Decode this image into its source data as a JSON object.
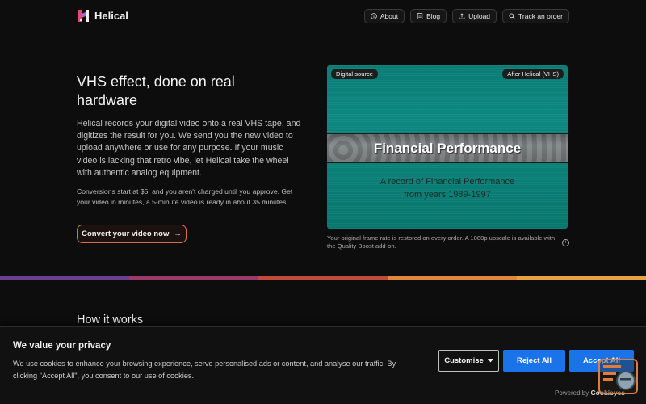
{
  "header": {
    "brand": "Helical",
    "nav": [
      {
        "label": "About",
        "icon": "info-icon"
      },
      {
        "label": "Blog",
        "icon": "document-icon"
      },
      {
        "label": "Upload",
        "icon": "upload-icon"
      },
      {
        "label": "Track an order",
        "icon": "search-icon"
      }
    ]
  },
  "hero": {
    "title": "VHS effect, done on real hardware",
    "description": "Helical records your digital video onto a real VHS tape, and digitizes the result for you. We send you the new video to upload anywhere or use for any purpose. If your music video is lacking that retro vibe, let Helical take the wheel with authentic analog equipment.",
    "note": "Conversions start at $5, and you aren't charged until you approve. Get your video in minutes, a 5-minute video is ready in about 35 minutes.",
    "cta_label": "Convert your video now",
    "cta_arrow": "→"
  },
  "video": {
    "badge_left": "Digital source",
    "badge_right": "After Helical (VHS)",
    "band_title": "Financial Performance",
    "sub_line1": "A record of Financial Performance",
    "sub_line2": "from years 1989-1997",
    "caption": "Your original frame rate is restored on every order. A 1080p upscale is available with the Quality Boost add-on.",
    "info_glyph": "i"
  },
  "colors": {
    "stripe": [
      "#6a3f8f",
      "#9a3a6c",
      "#c24a3c",
      "#e0873a",
      "#e8a23f"
    ],
    "accent": "#d47148",
    "cookie_button": "#1a73e8"
  },
  "how_it_works": {
    "title": "How it works"
  },
  "cookie": {
    "title": "We value your privacy",
    "text": "We use cookies to enhance your browsing experience, serve personalised ads or content, and analyse our traffic. By clicking \"Accept All\", you consent to our use of cookies.",
    "customise": "Customise",
    "reject": "Reject All",
    "accept": "Accept All",
    "powered_prefix": "Powered by",
    "powered_brand": "Cookieyes"
  }
}
